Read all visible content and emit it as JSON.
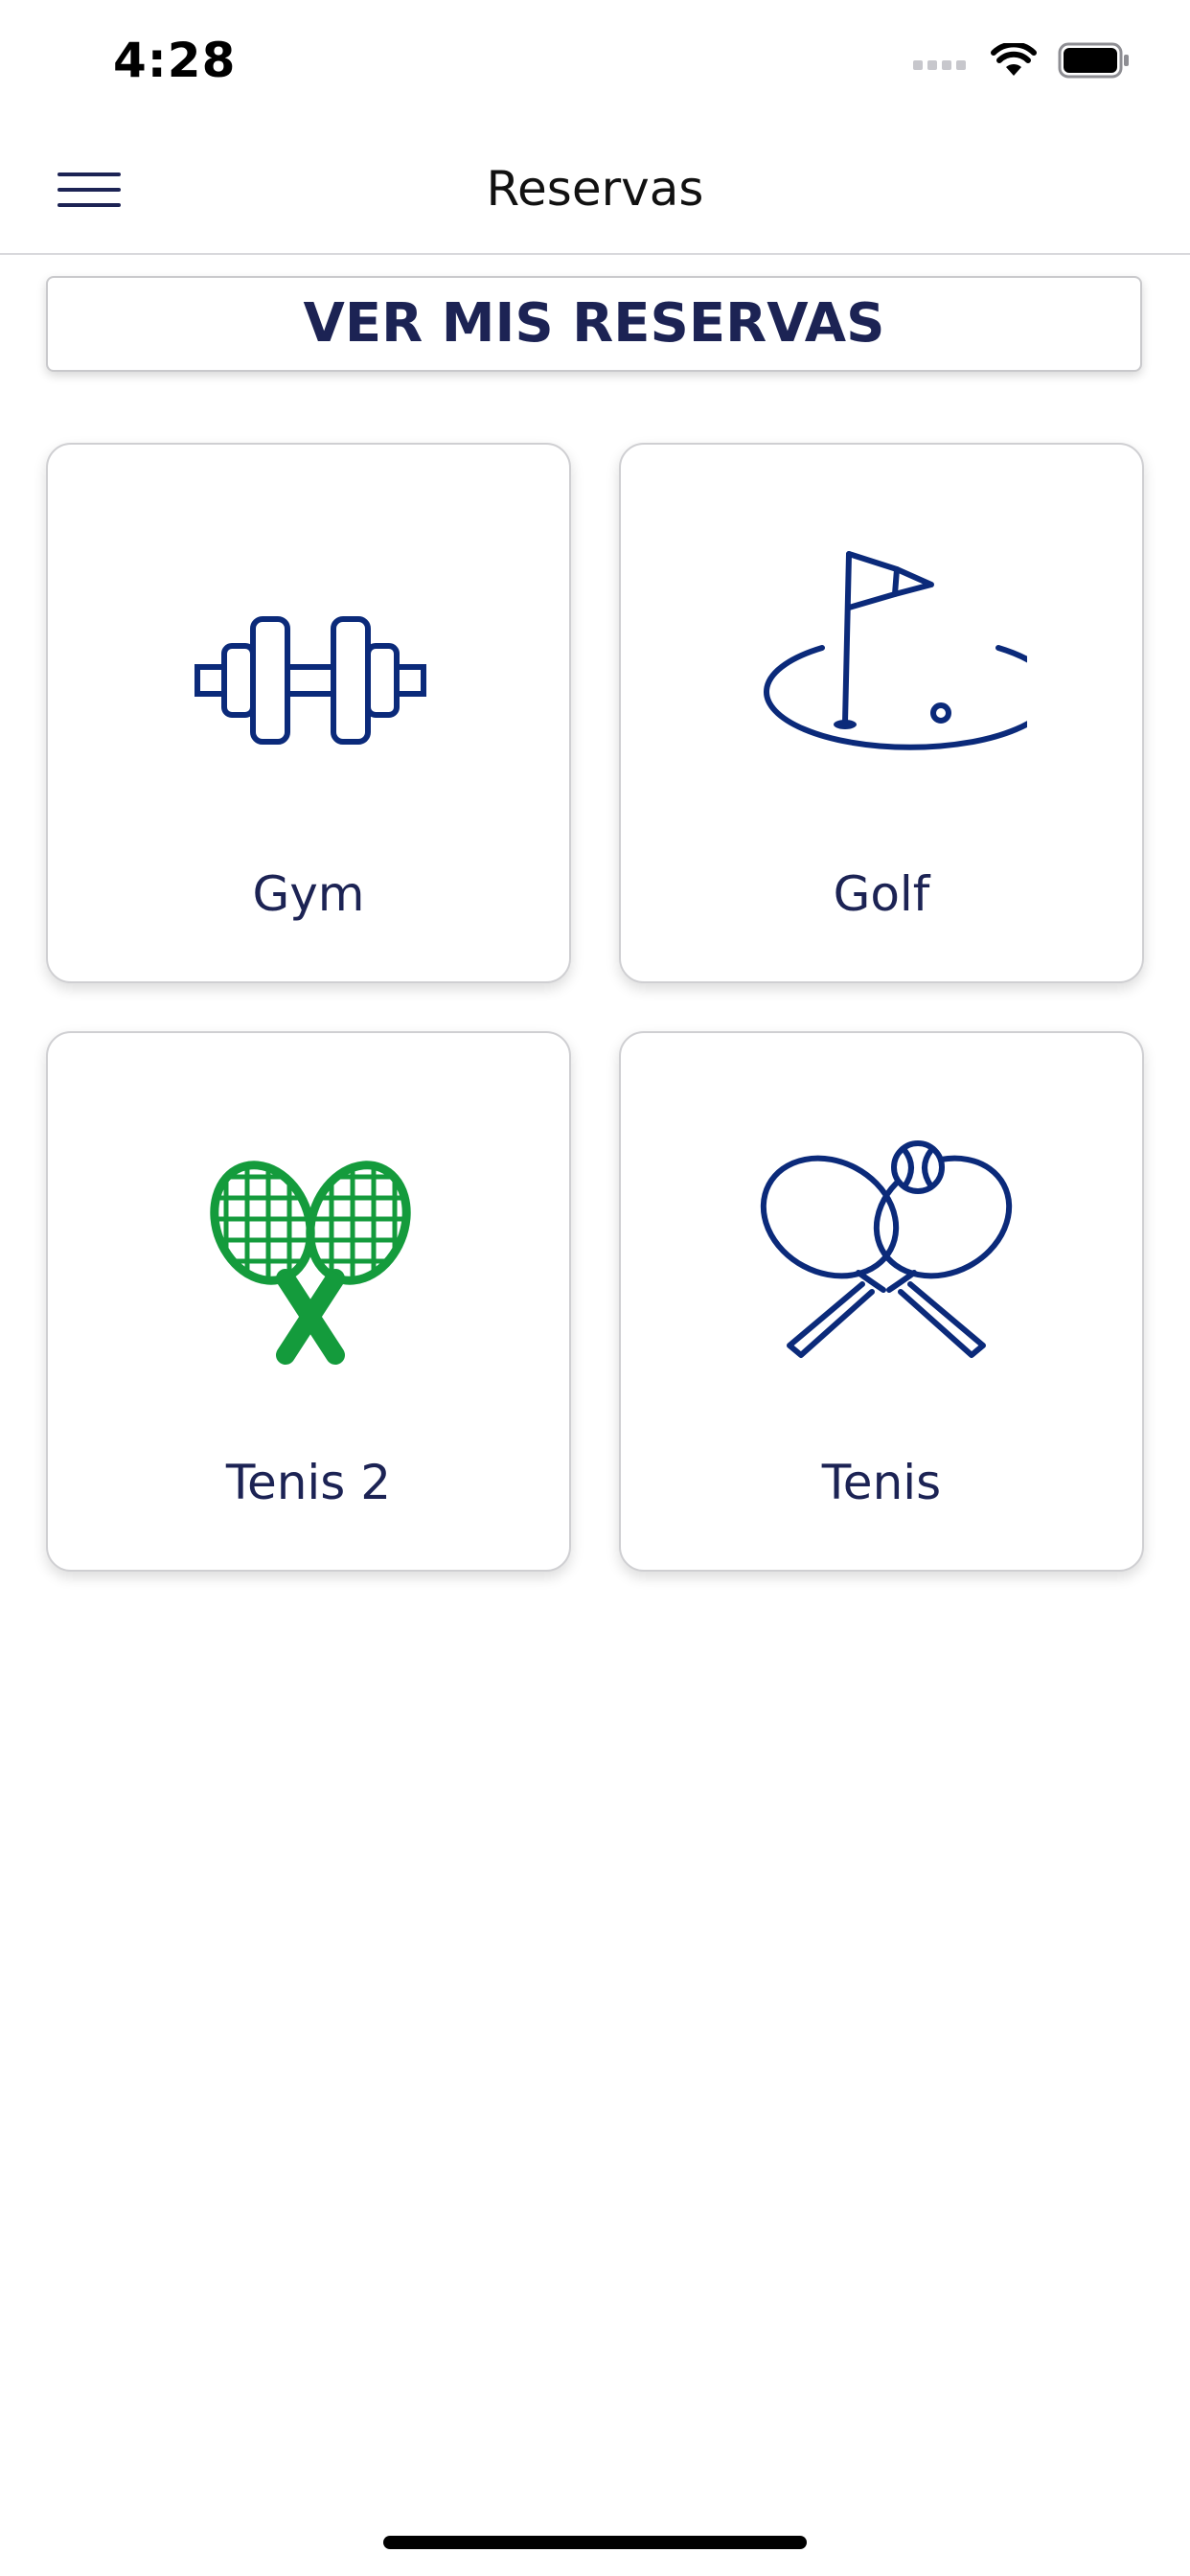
{
  "status_bar": {
    "time": "4:28",
    "icons": [
      "signal-icon",
      "wifi-icon",
      "battery-icon"
    ]
  },
  "nav": {
    "title": "Reservas",
    "menu_icon": "hamburger-menu-icon"
  },
  "reservas_button": {
    "label": "VER MIS RESERVAS"
  },
  "cards": [
    {
      "label": "Gym",
      "icon": "dumbbell-icon",
      "color": "#0b2a7a"
    },
    {
      "label": "Golf",
      "icon": "golf-flag-icon",
      "color": "#0b2a7a"
    },
    {
      "label": "Tenis 2",
      "icon": "tennis-rackets-green-icon",
      "color": "#149b3c"
    },
    {
      "label": "Tenis",
      "icon": "tennis-rackets-ball-icon",
      "color": "#0b2a7a"
    }
  ],
  "colors": {
    "accent": "#1c2354",
    "icon_blue": "#0b2a7a",
    "icon_green": "#149b3c"
  }
}
